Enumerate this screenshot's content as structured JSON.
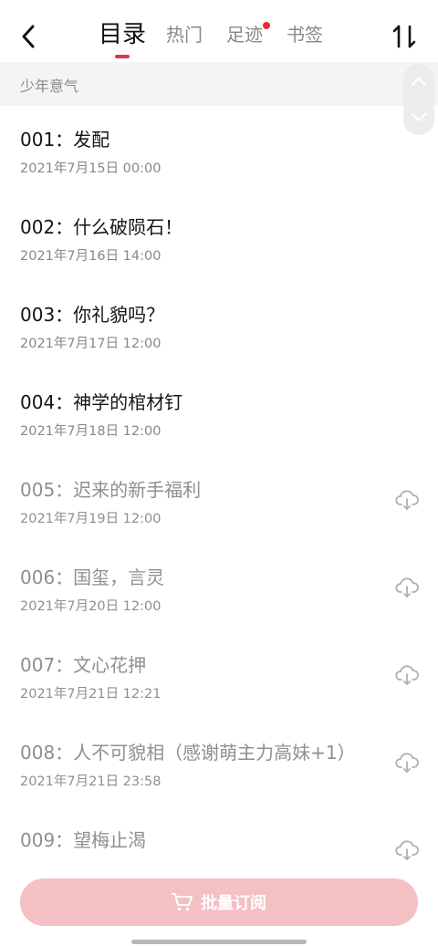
{
  "header": {
    "tabs": [
      {
        "label": "目录"
      },
      {
        "label": "热门"
      },
      {
        "label": "足迹"
      },
      {
        "label": "书签"
      }
    ],
    "active_tab": "目录",
    "back_icon": "chevron-left-icon",
    "sort_icon": "sort-arrows-icon",
    "accent_color": "#d83a45",
    "badge_color": "#e0303a"
  },
  "section": {
    "title": "少年意气"
  },
  "chapters": [
    {
      "title": "001：发配",
      "date": "2021年7月15日 00:00",
      "locked": false
    },
    {
      "title": "002：什么破陨石！",
      "date": "2021年7月16日 14:00",
      "locked": false
    },
    {
      "title": "003：你礼貌吗？",
      "date": "2021年7月17日 12:00",
      "locked": false
    },
    {
      "title": "004：神学的棺材钉",
      "date": "2021年7月18日 12:00",
      "locked": false
    },
    {
      "title": "005：迟来的新手福利",
      "date": "2021年7月19日 12:00",
      "locked": true
    },
    {
      "title": "006：国玺，言灵",
      "date": "2021年7月20日 12:00",
      "locked": true
    },
    {
      "title": "007：文心花押",
      "date": "2021年7月21日 12:21",
      "locked": true
    },
    {
      "title": "008：人不可貌相（感谢萌主力高妹+1）",
      "date": "2021年7月21日 23:58",
      "locked": true
    },
    {
      "title": "009：望梅止渴",
      "date": "",
      "locked": true
    }
  ],
  "footer": {
    "subscribe_label": "批量订阅",
    "button_color": "#f4c0c3"
  }
}
